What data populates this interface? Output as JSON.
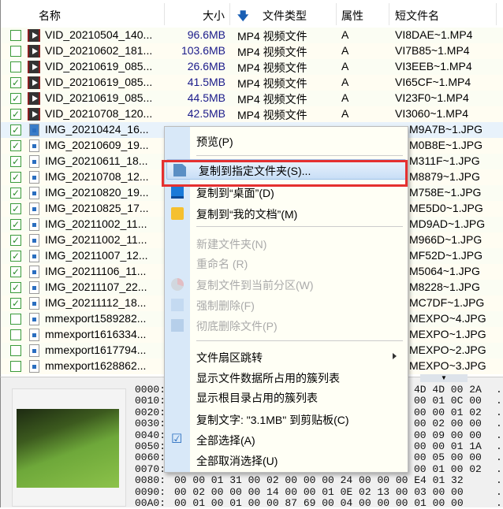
{
  "columns": {
    "name": "名称",
    "size": "大小",
    "sort_icon": "arrow-down-icon",
    "type": "文件类型",
    "attr": "属性",
    "short": "短文件名"
  },
  "rows": [
    {
      "checked": false,
      "kind": "vid",
      "name": "VID_20210504_140...",
      "size": "96.6MB",
      "type": "MP4 视频文件",
      "attr": "A",
      "short": "VI8DAE~1.MP4"
    },
    {
      "checked": false,
      "kind": "vid",
      "name": "VID_20210602_181...",
      "size": "103.6MB",
      "type": "MP4 视频文件",
      "attr": "A",
      "short": "VI7B85~1.MP4"
    },
    {
      "checked": false,
      "kind": "vid",
      "name": "VID_20210619_085...",
      "size": "26.6MB",
      "type": "MP4 视频文件",
      "attr": "A",
      "short": "VI3EEB~1.MP4"
    },
    {
      "checked": true,
      "kind": "vid",
      "name": "VID_20210619_085...",
      "size": "41.5MB",
      "type": "MP4 视频文件",
      "attr": "A",
      "short": "VI65CF~1.MP4"
    },
    {
      "checked": true,
      "kind": "vid",
      "name": "VID_20210619_085...",
      "size": "44.5MB",
      "type": "MP4 视频文件",
      "attr": "A",
      "short": "VI23F0~1.MP4"
    },
    {
      "checked": true,
      "kind": "vid",
      "name": "VID_20210708_120...",
      "size": "42.5MB",
      "type": "MP4 视频文件",
      "attr": "A",
      "short": "VI3060~1.MP4"
    },
    {
      "checked": true,
      "kind": "img",
      "name": "IMG_20210424_16...",
      "short": "M9A7B~1.JPG"
    },
    {
      "checked": true,
      "kind": "img",
      "name": "IMG_20210609_19...",
      "short": "M0B8E~1.JPG"
    },
    {
      "checked": true,
      "kind": "img",
      "name": "IMG_20210611_18...",
      "short": "M311F~1.JPG"
    },
    {
      "checked": true,
      "kind": "img",
      "name": "IMG_20210708_12...",
      "short": "M8879~1.JPG"
    },
    {
      "checked": true,
      "kind": "img",
      "name": "IMG_20210820_19...",
      "short": "M758E~1.JPG"
    },
    {
      "checked": true,
      "kind": "img",
      "name": "IMG_20210825_17...",
      "short": "ME5D0~1.JPG"
    },
    {
      "checked": true,
      "kind": "img",
      "name": "IMG_20211002_11...",
      "short": "MD9AD~1.JPG"
    },
    {
      "checked": true,
      "kind": "img",
      "name": "IMG_20211002_11...",
      "short": "M966D~1.JPG"
    },
    {
      "checked": true,
      "kind": "img",
      "name": "IMG_20211007_12...",
      "short": "MF52D~1.JPG"
    },
    {
      "checked": true,
      "kind": "img",
      "name": "IMG_20211106_11...",
      "short": "M5064~1.JPG"
    },
    {
      "checked": true,
      "kind": "img",
      "name": "IMG_20211107_22...",
      "short": "M8228~1.JPG"
    },
    {
      "checked": true,
      "kind": "img",
      "name": "IMG_20211112_18...",
      "short": "MC7DF~1.JPG"
    },
    {
      "checked": false,
      "kind": "img",
      "name": "mmexport1589282...",
      "short": "MEXPO~4.JPG"
    },
    {
      "checked": false,
      "kind": "img",
      "name": "mmexport1616334...",
      "short": "MEXPO~1.JPG"
    },
    {
      "checked": false,
      "kind": "img",
      "name": "mmexport1617794...",
      "short": "MEXPO~2.JPG"
    },
    {
      "checked": false,
      "kind": "img",
      "name": "mmexport1628862...",
      "short": "MEXPO~3.JPG"
    }
  ],
  "menu": [
    {
      "label": "预览(P)",
      "icon": null,
      "disabled": false
    },
    {
      "sep": true
    },
    {
      "label": "复制到指定文件夹(S)...",
      "icon": "copy-to-folder-icon",
      "highlight": true
    },
    {
      "label": "复制到“桌面”(D)",
      "icon": "desktop-icon"
    },
    {
      "label": "复制到“我的文档”(M)",
      "icon": "folder-icon"
    },
    {
      "sep": true
    },
    {
      "label": "新建文件夹(N)",
      "disabled": true
    },
    {
      "label": "重命名 (R)",
      "disabled": true
    },
    {
      "label": "复制文件到当前分区(W)",
      "icon": "pie-icon",
      "disabled": true
    },
    {
      "label": "强制删除(F)",
      "icon": "force-delete-icon",
      "disabled": true
    },
    {
      "label": "彻底删除文件(P)",
      "icon": "shred-icon",
      "disabled": true
    },
    {
      "sep": true
    },
    {
      "label": "文件扇区跳转",
      "submenu": true
    },
    {
      "label": "显示文件数据所占用的簇列表"
    },
    {
      "label": "显示根目录占用的簇列表"
    },
    {
      "label": "复制文字: \"3.1MB\" 到剪贴板(C)"
    },
    {
      "label": "全部选择(A)",
      "icon": "checkbox-icon"
    },
    {
      "label": "全部取消选择(U)"
    }
  ],
  "hex": {
    "offsets": [
      "0000:",
      "0010:",
      "0020:",
      "0030:",
      "0040:",
      "0050:",
      "0060:",
      "0070:",
      "0080:",
      "0090:",
      "00A0:"
    ],
    "partial": [
      "4D 4D 00 2A",
      "00 01 0C 00",
      "00 00 01 02",
      "00 02 00 00",
      "00 09 00 00",
      "00 00 01 1A",
      "00 05 00 00",
      "00 01 00 02"
    ],
    "full": [
      "00 00 01 31 00 02 00 00 00 24 00 00 00 E4 01 32",
      "00 02 00 00 00 14 00 00 01 0E 02 13 00 03 00 00",
      "00 01 00 01 00 00 87 69 00 04 00 00 00 01 00 00"
    ]
  }
}
